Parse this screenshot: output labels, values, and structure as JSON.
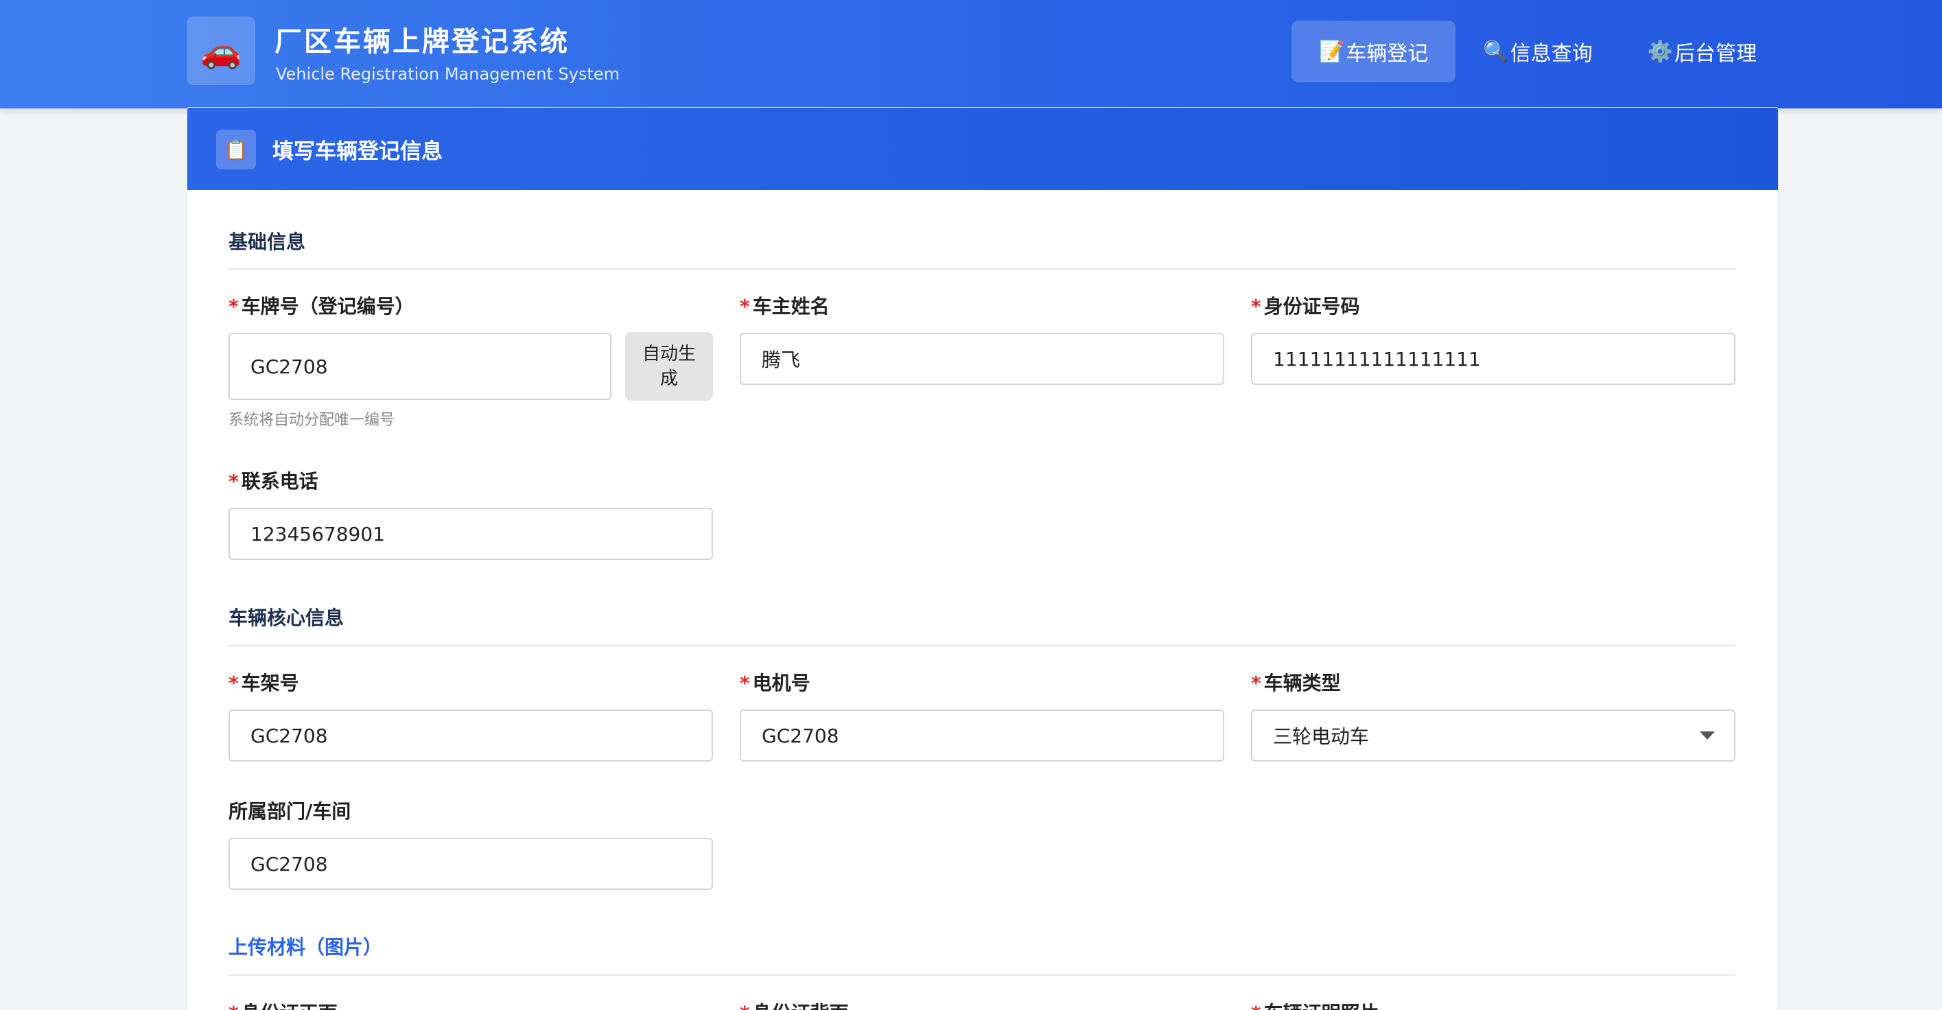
{
  "header": {
    "logo_icon": "🚗",
    "title": "厂区车辆上牌登记系统",
    "subtitle": "Vehicle Registration Management System",
    "nav": [
      {
        "icon": "📝",
        "label": "车辆登记",
        "active": true
      },
      {
        "icon": "🔍",
        "label": "信息查询",
        "active": false
      },
      {
        "icon": "⚙️",
        "label": "后台管理",
        "active": false
      }
    ]
  },
  "card": {
    "icon": "📋",
    "title": "填写车辆登记信息"
  },
  "sections": {
    "basic": "基础信息",
    "core": "车辆核心信息",
    "upload": "上传材料（图片）"
  },
  "fields": {
    "plate": {
      "label": "车牌号（登记编号）",
      "value": "GC2708",
      "hint": "系统将自动分配唯一编号",
      "button": "自动生成",
      "required": true
    },
    "owner": {
      "label": "车主姓名",
      "value": "腾飞",
      "required": true
    },
    "idcard": {
      "label": "身份证号码",
      "value": "11111111111111111",
      "required": true
    },
    "phone": {
      "label": "联系电话",
      "value": "12345678901",
      "required": true
    },
    "frame": {
      "label": "车架号",
      "value": "GC2708",
      "required": true
    },
    "engine": {
      "label": "电机号",
      "value": "GC2708",
      "required": true
    },
    "type": {
      "label": "车辆类型",
      "value": "三轮电动车",
      "required": true
    },
    "dept": {
      "label": "所属部门/车间",
      "value": "GC2708",
      "required": false
    },
    "id_front": {
      "label": "身份证正面",
      "required": true
    },
    "id_back": {
      "label": "身份证背面",
      "required": true
    },
    "vehicle_photo": {
      "label": "车辆证明照片",
      "required": true
    }
  },
  "required_mark": "*",
  "colors": {
    "primary": "#2a63e6",
    "required": "#e02424"
  }
}
